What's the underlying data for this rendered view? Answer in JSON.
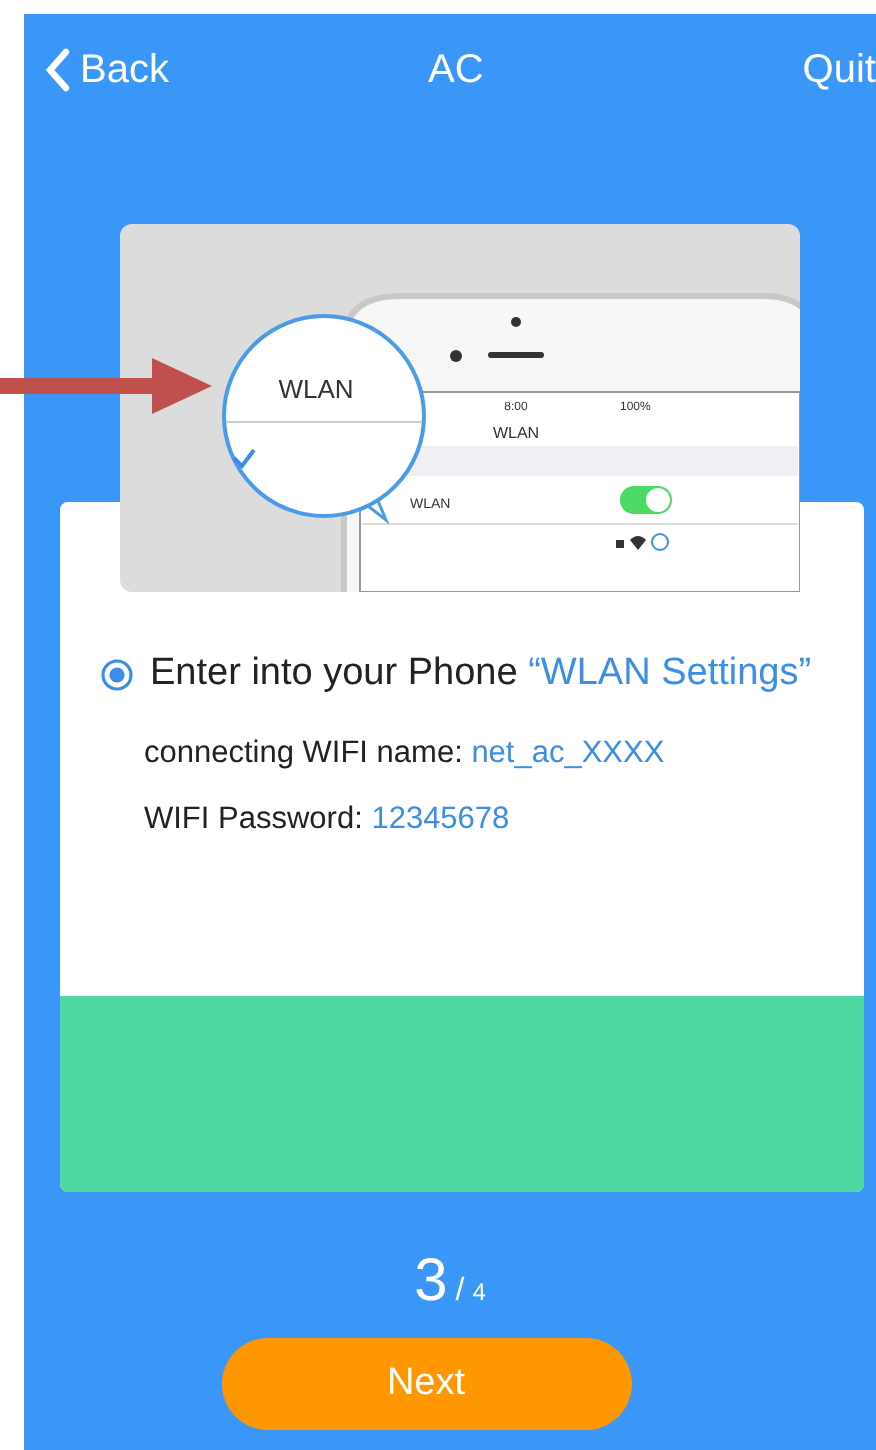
{
  "header": {
    "back": "Back",
    "title": "AC",
    "quit": "Quit"
  },
  "illustration": {
    "magnifier_label": "WLAN",
    "phone_time": "8:00",
    "phone_battery": "100%",
    "phone_title": "WLAN",
    "phone_row_label": "WLAN",
    "wlan_toggle_on": true
  },
  "instruction": {
    "selected": true,
    "text": "Enter into your Phone",
    "highlight": "“WLAN Settings”"
  },
  "details": [
    {
      "label": "connecting WIFI name:",
      "value": "net_ac_XXXX"
    },
    {
      "label": "WIFI Password:",
      "value": "12345678"
    }
  ],
  "pager": {
    "current": "3",
    "separator": "/",
    "total": "4"
  },
  "next_button": "Next"
}
